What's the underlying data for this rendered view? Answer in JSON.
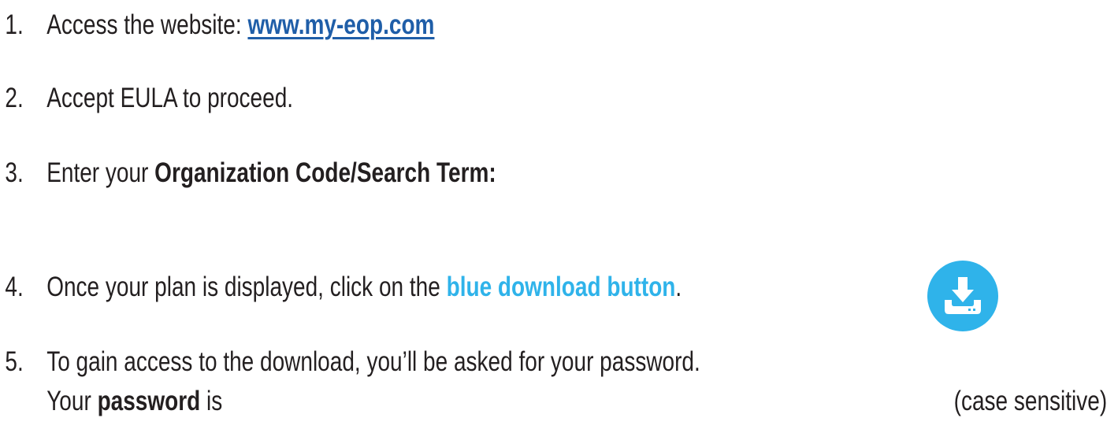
{
  "steps": [
    {
      "number": "1.",
      "text": "Access the website: ",
      "link": "www.my-eop.com"
    },
    {
      "number": "2.",
      "text": "Accept EULA to proceed."
    },
    {
      "number": "3.",
      "text": "Enter your ",
      "bold": "Organization Code/Search Term:"
    },
    {
      "number": "4.",
      "text": "Once your plan is displayed, click on the ",
      "highlight": "blue download button",
      "suffix": "."
    },
    {
      "number": "5.",
      "text": "To gain access to the download, you’ll be asked for your password.",
      "line2_prefix": "Your ",
      "line2_bold": "password",
      "line2_suffix": " is",
      "case_note": "(case sensitive)"
    }
  ],
  "download_button": {
    "icon": "download-icon",
    "color": "#2fb3ea"
  },
  "colors": {
    "text": "#231f20",
    "link": "#1f5ea8",
    "highlight": "#2fb3ea"
  }
}
